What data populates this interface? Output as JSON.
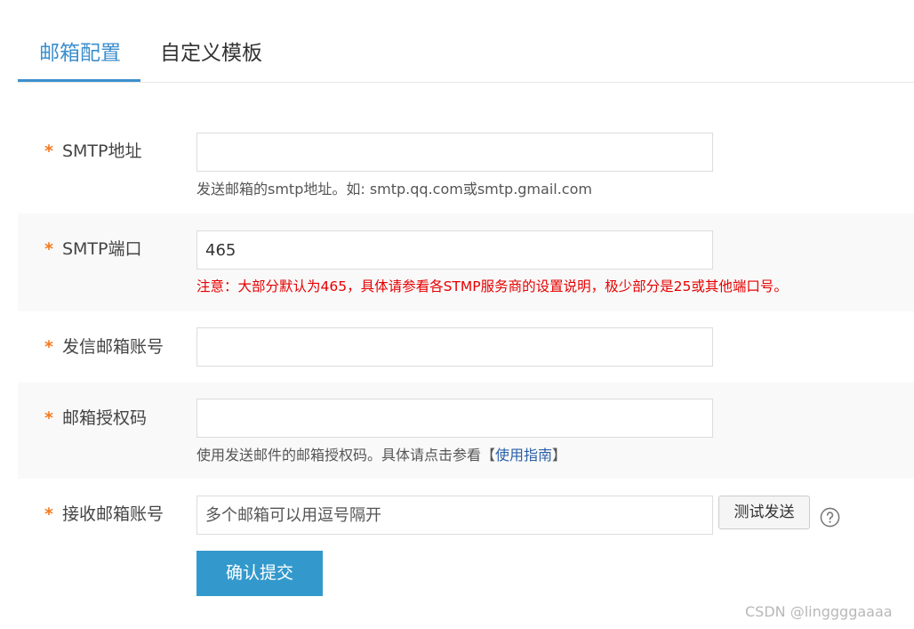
{
  "tabs": [
    {
      "label": "邮箱配置",
      "active": true
    },
    {
      "label": "自定义模板",
      "active": false
    }
  ],
  "form": {
    "required_mark": "*",
    "smtp_host": {
      "label": "SMTP地址",
      "value": "",
      "placeholder": "",
      "hint": "发送邮箱的smtp地址。如: smtp.qq.com或smtp.gmail.com"
    },
    "smtp_port": {
      "label": "SMTP端口",
      "value": "465",
      "hint": "注意：大部分默认为465，具体请参看各STMP服务商的设置说明，极少部分是25或其他端口号。"
    },
    "sender_account": {
      "label": "发信邮箱账号",
      "value": ""
    },
    "auth_code": {
      "label": "邮箱授权码",
      "value": "",
      "hint_text": "使用发送邮件的邮箱授权码。具体请点击参看【",
      "hint_link": "使用指南",
      "hint_end": "】"
    },
    "receiver_account": {
      "label": "接收邮箱账号",
      "value": "",
      "placeholder": "多个邮箱可以用逗号隔开",
      "test_button": "测试发送",
      "help_icon": "question-circle-icon"
    },
    "submit_label": "确认提交"
  },
  "watermark": "CSDN @linggggaaaa",
  "colors": {
    "accent": "#3c8fce",
    "required_star": "#f47a20",
    "warning_text": "#e60000",
    "submit_bg": "#3399cc",
    "link": "#2a5fa6"
  }
}
